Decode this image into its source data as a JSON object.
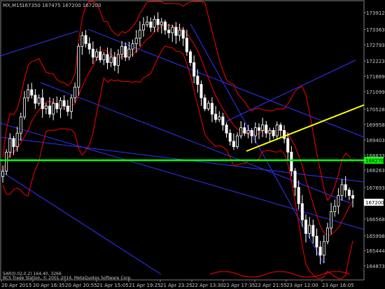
{
  "header": {
    "symbol": "MX,M15",
    "ohlc": "167350 167475 167200 167200"
  },
  "footer": {
    "indicator": "SAR(0.02,0.2) 164,40, 3266",
    "copyright": "BCS Trade Station, © 2001-2014, MetaQuotes Software Corp."
  },
  "colors": {
    "background": "#000000",
    "candles": "#ffffff",
    "bollinger": "#ff0000",
    "trendlines": "#3333ff",
    "horizontal_level": "#00ff00",
    "yellow_trendline": "#ffff00",
    "current_price_bg": "#ffffff"
  },
  "current_price_label": "167200",
  "level_price_label": "168270",
  "chart_data": {
    "type": "candlestick",
    "timeframe": "M15",
    "y_ticks": [
      "173912",
      "173363",
      "172793",
      "172223",
      "171669",
      "171099",
      "170528",
      "169958",
      "169403",
      "168833",
      "168263",
      "167693",
      "167200",
      "166568",
      "165998",
      "165444",
      "164873"
    ],
    "x_ticks": [
      "20 Apr 2015",
      "20 Apr 16:35",
      "20 Apr 20:55",
      "21 Apr 15:05",
      "21 Apr 19:25",
      "21 Apr 23:25",
      "22 Apr 13:30",
      "22 Apr 17:35",
      "22 Apr 21:55",
      "23 Apr 12:00",
      "23 Apr 16:05"
    ],
    "ylim": [
      164600,
      174200
    ],
    "price_path": [
      168200,
      168900,
      169400,
      169100,
      169600,
      170200,
      170900,
      171200,
      171000,
      170700,
      170900,
      170500,
      170600,
      170300,
      170700,
      170500,
      170800,
      170600,
      170400,
      170900,
      171300,
      172800,
      173200,
      172900,
      172700,
      172400,
      172600,
      172300,
      172500,
      172200,
      172400,
      172100,
      172500,
      172800,
      172400,
      172700,
      172900,
      173100,
      173400,
      173600,
      173700,
      173500,
      173800,
      173600,
      173700,
      173400,
      173300,
      173500,
      173200,
      173400,
      173100,
      172600,
      172200,
      171700,
      171400,
      170900,
      170500,
      170700,
      170300,
      170100,
      170200,
      169900,
      169600,
      169300,
      169100,
      169500,
      169800,
      169600,
      169700,
      169500,
      169800,
      169700,
      169900,
      169600,
      169700,
      169500,
      169900,
      169700,
      169400,
      168900,
      168200,
      167600,
      167000,
      166400,
      165900,
      166200,
      165800,
      165400,
      165100,
      165600,
      166100,
      166700,
      166900,
      167300,
      167700,
      167500,
      167300,
      167200
    ],
    "horizontal_level": 168270
  }
}
